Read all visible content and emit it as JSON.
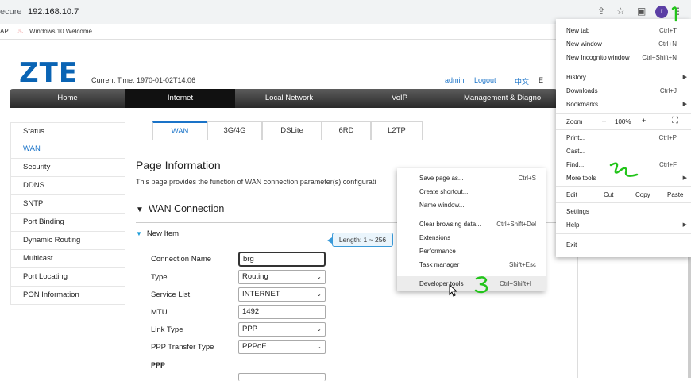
{
  "browser": {
    "url_prefix": "ecure",
    "url": "192.168.10.7",
    "avatar_letter": "f",
    "bookmarks": [
      "AP",
      "Windows 10 Welcome ."
    ]
  },
  "header": {
    "logo": "ZTE",
    "current_time": "Current Time: 1970-01-02T14:06",
    "admin": "admin",
    "logout": "Logout",
    "lang": "中文",
    "lang_extra": "E"
  },
  "nav": [
    "Home",
    "Internet",
    "Local Network",
    "VoIP",
    "Management & Diagno"
  ],
  "sidebar": [
    "Status",
    "WAN",
    "Security",
    "DDNS",
    "SNTP",
    "Port Binding",
    "Dynamic Routing",
    "Multicast",
    "Port Locating",
    "PON Information"
  ],
  "tabs": [
    "WAN",
    "3G/4G",
    "DSLite",
    "6RD",
    "L2TP"
  ],
  "page": {
    "title": "Page Information",
    "description": "This page provides the function of WAN connection parameter(s) configurati",
    "wan_heading": "WAN Connection",
    "new_item": "New Item",
    "tooltip": "Length: 1 ~ 256",
    "ppp_label": "PPP",
    "fields": [
      {
        "label": "Connection Name",
        "value": "brg"
      },
      {
        "label": "Type",
        "value": "Routing"
      },
      {
        "label": "Service List",
        "value": "INTERNET"
      },
      {
        "label": "MTU",
        "value": "1492"
      },
      {
        "label": "Link Type",
        "value": "PPP"
      },
      {
        "label": "PPP Transfer Type",
        "value": "PPPoE"
      }
    ]
  },
  "chrome_menu": {
    "new_tab": "New tab",
    "new_tab_sc": "Ctrl+T",
    "new_window": "New window",
    "new_window_sc": "Ctrl+N",
    "incognito": "New Incognito window",
    "incognito_sc": "Ctrl+Shift+N",
    "history": "History",
    "downloads": "Downloads",
    "downloads_sc": "Ctrl+J",
    "bookmarks": "Bookmarks",
    "zoom": "Zoom",
    "zoom_minus": "–",
    "zoom_level": "100%",
    "zoom_plus": "+",
    "print": "Print...",
    "print_sc": "Ctrl+P",
    "cast": "Cast...",
    "find": "Find...",
    "find_sc": "Ctrl+F",
    "more_tools": "More tools",
    "edit": "Edit",
    "cut": "Cut",
    "copy": "Copy",
    "paste": "Paste",
    "settings": "Settings",
    "help": "Help",
    "exit": "Exit"
  },
  "more_tools": {
    "save_page": "Save page as...",
    "save_page_sc": "Ctrl+S",
    "create_shortcut": "Create shortcut...",
    "name_window": "Name window...",
    "clear_data": "Clear browsing data...",
    "clear_data_sc": "Ctrl+Shift+Del",
    "extensions": "Extensions",
    "performance": "Performance",
    "task_manager": "Task manager",
    "task_manager_sc": "Shift+Esc",
    "dev_tools": "Developer tools",
    "dev_tools_sc": "Ctrl+Shift+I"
  },
  "annotations": {
    "accent_color": "#22c41a"
  }
}
